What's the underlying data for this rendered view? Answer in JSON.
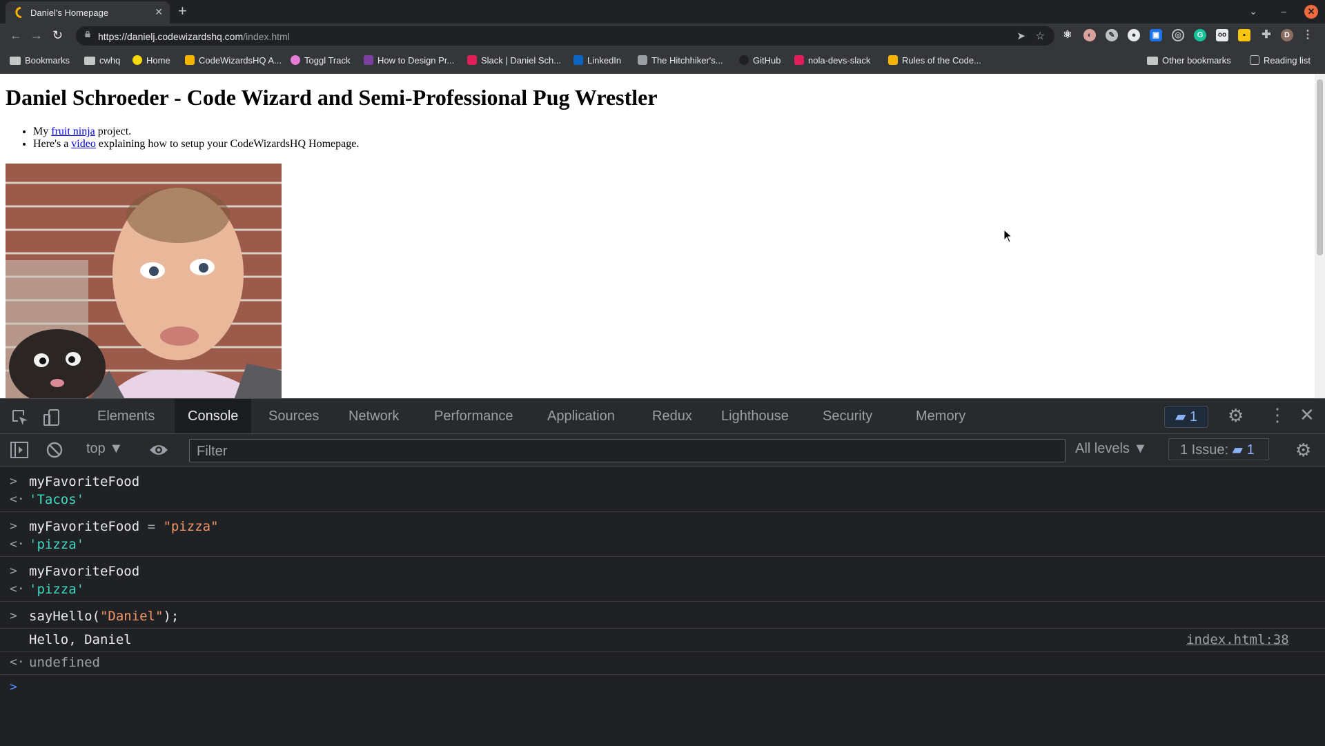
{
  "browser": {
    "tab_title": "Daniel's Homepage",
    "url_host": "https://danielj.codewizardshq.com",
    "url_path": "/index.html",
    "bookmarks": [
      {
        "label": "Bookmarks",
        "icon": "folder-icon"
      },
      {
        "label": "cwhq",
        "icon": "folder-icon"
      },
      {
        "label": "Home",
        "icon": "home-favicon"
      },
      {
        "label": "CodeWizardsHQ A...",
        "icon": "codewizards-favicon"
      },
      {
        "label": "Toggl Track",
        "icon": "toggl-favicon"
      },
      {
        "label": "How to Design Pr...",
        "icon": "htdp-favicon"
      },
      {
        "label": "Slack | Daniel Sch...",
        "icon": "slack-favicon"
      },
      {
        "label": "LinkedIn",
        "icon": "linkedin-favicon"
      },
      {
        "label": "The Hitchhiker's...",
        "icon": "hitchhiker-favicon"
      },
      {
        "label": "GitHub",
        "icon": "github-favicon"
      },
      {
        "label": "nola-devs-slack",
        "icon": "slack-favicon"
      },
      {
        "label": "Rules of the Code...",
        "icon": "codewizards-favicon"
      }
    ],
    "other_bookmarks": "Other bookmarks",
    "reading_list": "Reading list"
  },
  "page": {
    "heading": "Daniel Schroeder - Code Wizard and Semi-Professional Pug Wrestler",
    "item1_prefix": "My ",
    "item1_link": "fruit ninja",
    "item1_suffix": " project.",
    "item2_prefix": "Here's a ",
    "item2_link": "video",
    "item2_suffix": " explaining how to setup your CodeWizardsHQ Homepage."
  },
  "devtools": {
    "tabs": [
      "Elements",
      "Console",
      "Sources",
      "Network",
      "Performance",
      "Application",
      "Redux",
      "Lighthouse",
      "Security",
      "Memory"
    ],
    "active_tab": "Console",
    "message_count": "1",
    "context": "top",
    "filter_placeholder": "Filter",
    "levels": "All levels",
    "issues_label": "1 Issue:",
    "issues_count": "1"
  },
  "console": {
    "in1": "myFavoriteFood",
    "out1": "'Tacos'",
    "in2_lhs": "myFavoriteFood",
    "in2_op": " = ",
    "in2_rhs": "\"pizza\"",
    "out2": "'pizza'",
    "in3": "myFavoriteFood",
    "out3": "'pizza'",
    "in4_fn": "sayHello(",
    "in4_arg": "\"Daniel\"",
    "in4_end": ");",
    "log": "Hello, Daniel",
    "log_source": "index.html:38",
    "out4": "undefined"
  },
  "colors": {
    "console_string_result": "#3cdbc2",
    "console_string_input": "#f29766",
    "link": "#0000ee",
    "accent": "#8ab4f8"
  }
}
